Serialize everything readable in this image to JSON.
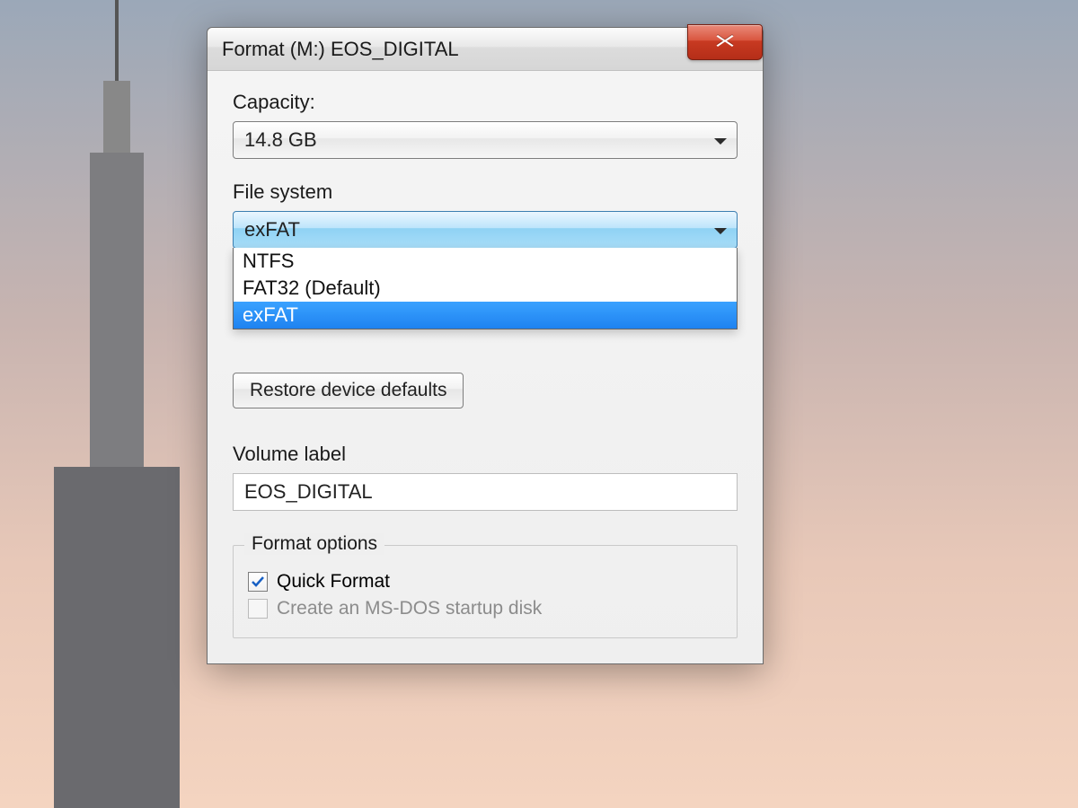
{
  "window": {
    "title": "Format (M:) EOS_DIGITAL"
  },
  "capacity": {
    "label": "Capacity:",
    "value": "14.8 GB"
  },
  "filesystem": {
    "label": "File system",
    "value": "exFAT",
    "options": [
      "NTFS",
      "FAT32 (Default)",
      "exFAT"
    ],
    "selected_index": 2
  },
  "restore_button": "Restore device defaults",
  "volume": {
    "label": "Volume label",
    "value": "EOS_DIGITAL"
  },
  "format_options": {
    "legend": "Format options",
    "quick_format": {
      "label": "Quick Format",
      "checked": true
    },
    "msdos_disk": {
      "label": "Create an MS-DOS startup disk",
      "checked": false,
      "disabled": true
    }
  }
}
